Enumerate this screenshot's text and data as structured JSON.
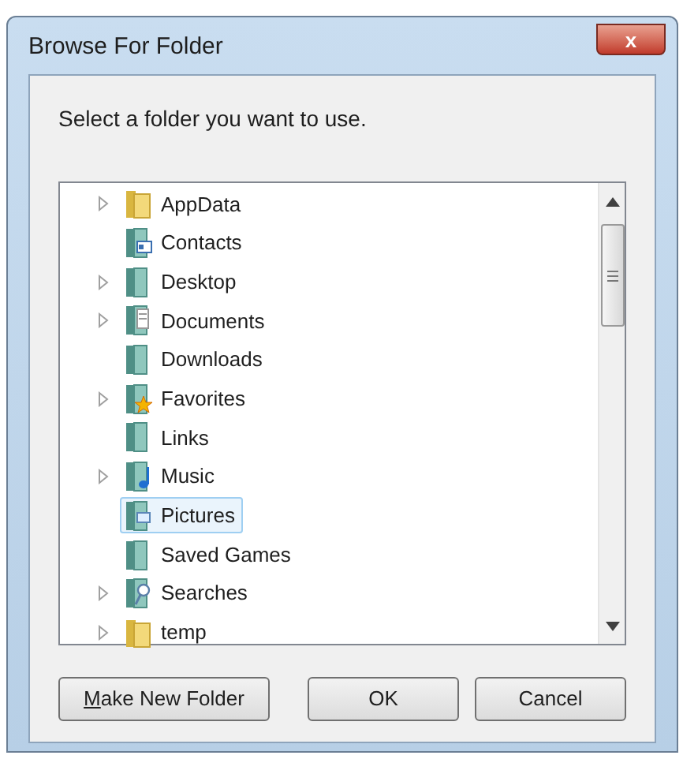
{
  "window": {
    "title": "Browse For Folder",
    "close": "x"
  },
  "prompt": "Select a folder you want to use.",
  "tree": {
    "items": [
      {
        "label": "AppData",
        "kind": "folder",
        "expandable": true,
        "selected": false
      },
      {
        "label": "Contacts",
        "kind": "contacts",
        "expandable": false,
        "selected": false
      },
      {
        "label": "Desktop",
        "kind": "plain",
        "expandable": true,
        "selected": false
      },
      {
        "label": "Documents",
        "kind": "documents",
        "expandable": true,
        "selected": false
      },
      {
        "label": "Downloads",
        "kind": "plain",
        "expandable": false,
        "selected": false
      },
      {
        "label": "Favorites",
        "kind": "favorites",
        "expandable": true,
        "selected": false
      },
      {
        "label": "Links",
        "kind": "plain",
        "expandable": false,
        "selected": false
      },
      {
        "label": "Music",
        "kind": "music",
        "expandable": true,
        "selected": false
      },
      {
        "label": "Pictures",
        "kind": "pictures",
        "expandable": false,
        "selected": true
      },
      {
        "label": "Saved Games",
        "kind": "plain",
        "expandable": false,
        "selected": false
      },
      {
        "label": "Searches",
        "kind": "searches",
        "expandable": true,
        "selected": false
      },
      {
        "label": "temp",
        "kind": "folder",
        "expandable": true,
        "selected": false
      }
    ]
  },
  "buttons": [
    {
      "label": "Make New Folder",
      "mnemonic": true
    },
    {
      "label": "OK",
      "mnemonic": false
    },
    {
      "label": "Cancel",
      "mnemonic": false
    }
  ]
}
